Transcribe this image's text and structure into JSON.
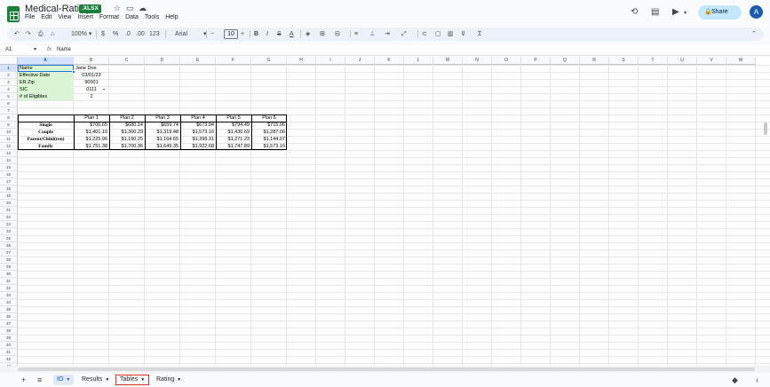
{
  "titlebar": {
    "doc_title": "Medical-Rating",
    "badge": ".XLSX",
    "menus": [
      "File",
      "Edit",
      "View",
      "Insert",
      "Format",
      "Data",
      "Tools",
      "Help"
    ],
    "share_label": "Share",
    "avatar_letter": "A"
  },
  "toolbar": {
    "zoom": "100%",
    "currency": "$",
    "percent": "%",
    "dec_less": ".0",
    "dec_more": ".00",
    "number_format": "123",
    "font": "Arial",
    "font_size": "10",
    "bold": "B",
    "italic": "I"
  },
  "formula_bar": {
    "cell_ref": "A1",
    "fx": "fx",
    "value": "Name"
  },
  "grid": {
    "columns": [
      "A",
      "B",
      "C",
      "D",
      "E",
      "F",
      "G",
      "H",
      "I",
      "J",
      "K",
      "L",
      "M",
      "N",
      "O",
      "P",
      "Q",
      "R",
      "S",
      "T",
      "U",
      "V",
      "W"
    ],
    "selected_column": "A",
    "rows": [
      "1",
      "2",
      "3",
      "4",
      "5",
      "6",
      "7",
      "8",
      "9",
      "10",
      "11",
      "12",
      "13",
      "14",
      "15",
      "16",
      "17",
      "18",
      "19",
      "20",
      "21",
      "22",
      "23",
      "24",
      "25",
      "26",
      "27",
      "28",
      "29",
      "30",
      "31",
      "32",
      "33",
      "34",
      "35",
      "36",
      "37",
      "38",
      "39",
      "40",
      "41",
      "42",
      "43",
      "44"
    ],
    "info_labels": [
      "Name",
      "Effective Date",
      "ER Zip",
      "SIC",
      "# of Eligibles"
    ],
    "info_values": [
      "Jane Doe",
      "03/01/23",
      "90001",
      "0111",
      "2"
    ],
    "plan_headers": [
      "Plan 1",
      "Plan 2",
      "Plan 3",
      "Plan 4",
      "Plan 5",
      "Plan 6"
    ],
    "rate_rows": [
      {
        "label": "Single",
        "values": [
          "$700.65",
          "$680.14",
          "$659.74",
          "$673.94",
          "$794.49",
          "$715.06"
        ]
      },
      {
        "label": "Couple",
        "values": [
          "$1,401.10",
          "$1,360.29",
          "$1,319.48",
          "$1,573.16",
          "$1,430.69",
          "$1,287.06"
        ]
      },
      {
        "label": "Parent/Child(ren)",
        "values": [
          "$1,225.96",
          "$1,190.25",
          "$1,164.65",
          "$1,398.31",
          "$1,271.23",
          "$1,144.07"
        ]
      },
      {
        "label": "Family",
        "values": [
          "$1,751.38",
          "$1,700.36",
          "$1,649.35",
          "$1,922.68",
          "$1,747.89",
          "$1,573.16"
        ]
      }
    ]
  },
  "sheets": {
    "tabs": [
      {
        "label": "IO",
        "active": true,
        "highlight": false
      },
      {
        "label": "Results",
        "active": false,
        "highlight": false
      },
      {
        "label": "Tables",
        "active": false,
        "highlight": true
      },
      {
        "label": "Rating",
        "active": false,
        "highlight": false
      }
    ]
  },
  "colors": {
    "green_fill": "#d9f5d3",
    "accent": "#1a73e8",
    "share_bg": "#c2e7ff",
    "sheets_green": "#188038",
    "highlight_red": "#d93025"
  }
}
